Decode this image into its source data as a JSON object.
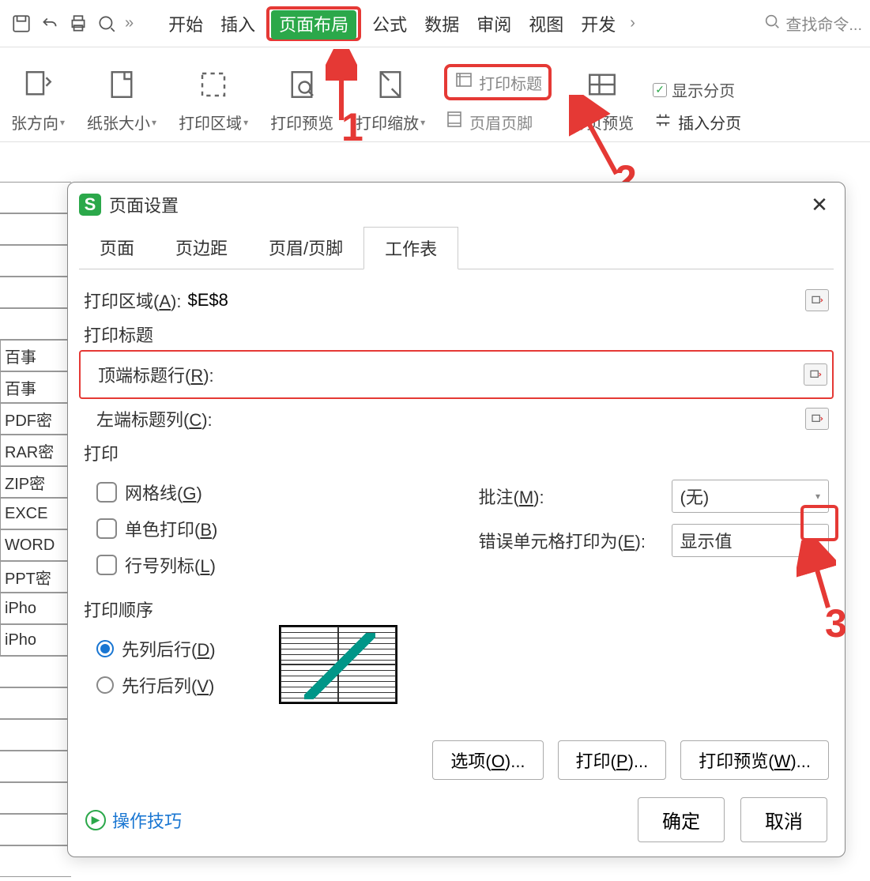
{
  "tabs": {
    "start": "开始",
    "insert": "插入",
    "page_layout": "页面布局",
    "formula": "公式",
    "data": "数据",
    "review": "审阅",
    "view": "视图",
    "dev": "开发"
  },
  "search": {
    "placeholder": "查找命令..."
  },
  "ribbon": {
    "orientation": "张方向",
    "paper_size": "纸张大小",
    "print_area": "打印区域",
    "print_preview": "打印预览",
    "print_scale": "打印缩放",
    "print_titles": "打印标题",
    "header_footer": "页眉页脚",
    "page_break_preview": "分页预览",
    "show_page_break": "显示分页",
    "insert_page_break": "插入分页"
  },
  "annotations": {
    "n1": "1",
    "n2": "2",
    "n3": "3"
  },
  "sheet_rows": [
    "",
    "",
    "",
    "",
    "",
    "百事",
    "百事",
    "PDF密",
    "RAR密",
    "ZIP密",
    "EXCE",
    "WORD",
    "PPT密",
    "iPho",
    "iPho",
    "",
    "",
    "",
    "",
    "",
    "",
    ""
  ],
  "dialog": {
    "title": "页面设置",
    "tabs": {
      "page": "页面",
      "margins": "页边距",
      "hf": "页眉/页脚",
      "sheet": "工作表"
    },
    "print_area_label": "打印区域(",
    "print_area_key": "A",
    "print_area_suffix": "):",
    "print_area_value": "$E$8",
    "print_titles": "打印标题",
    "top_row_label": "顶端标题行(",
    "top_row_key": "R",
    "top_row_suffix": "):",
    "left_col_label": "左端标题列(",
    "left_col_key": "C",
    "left_col_suffix": "):",
    "print_section": "打印",
    "gridlines": "网格线(",
    "gridlines_key": "G",
    "gridlines_suffix": ")",
    "mono": "单色打印(",
    "mono_key": "B",
    "mono_suffix": ")",
    "rowcol": "行号列标(",
    "rowcol_key": "L",
    "rowcol_suffix": ")",
    "comments_label": "批注(",
    "comments_key": "M",
    "comments_suffix": "):",
    "comments_value": "(无)",
    "errors_label": "错误单元格打印为(",
    "errors_key": "E",
    "errors_suffix": "):",
    "errors_value": "显示值",
    "order_section": "打印顺序",
    "down_over": "先列后行(",
    "down_over_key": "D",
    "down_over_suffix": ")",
    "over_down": "先行后列(",
    "over_down_key": "V",
    "over_down_suffix": ")",
    "options": "选项(",
    "options_key": "O",
    "options_suffix": ")...",
    "print": "打印(",
    "print_key": "P",
    "print_suffix": ")...",
    "preview": "打印预览(",
    "preview_key": "W",
    "preview_suffix": ")...",
    "tips": "操作技巧",
    "ok": "确定",
    "cancel": "取消"
  }
}
